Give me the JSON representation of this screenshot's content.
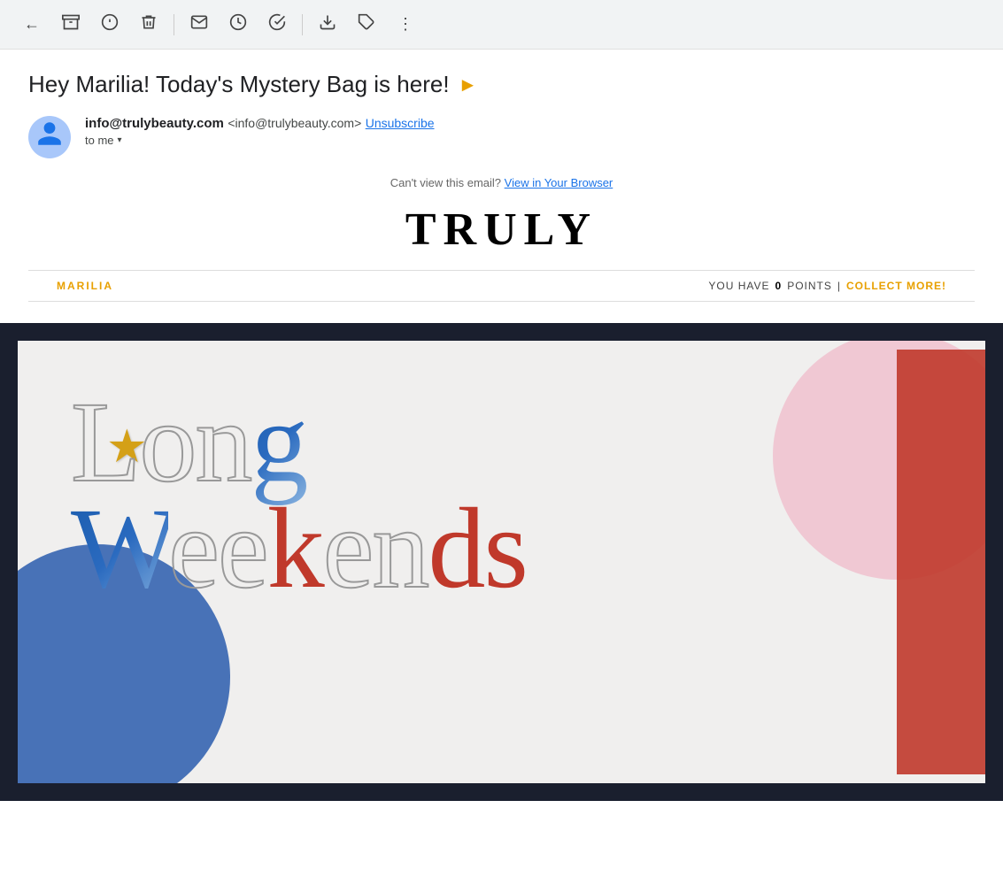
{
  "toolbar": {
    "back_icon": "←",
    "archive_icon": "⬇",
    "warning_icon": "⚠",
    "delete_icon": "🗑",
    "mail_icon": "✉",
    "clock_icon": "🕐",
    "check_icon": "✔",
    "download_icon": "⬇",
    "label_icon": "🏷",
    "more_icon": "⋮"
  },
  "email": {
    "subject": "Hey Marilia! Today's Mystery Bag is here!",
    "subject_arrow": "▶",
    "sender_display": "info@trulybeauty.com",
    "sender_email_bracket": "<info@trulybeauty.com>",
    "unsubscribe_label": "Unsubscribe",
    "to_label": "to me",
    "view_browser_text": "Can't view this email?",
    "view_browser_link": "View in Your Browser"
  },
  "brand": {
    "name": "TRULY"
  },
  "points_bar": {
    "user_name": "MARILIA",
    "points_prefix": "YOU HAVE",
    "points_value": "0",
    "points_suffix": "POINTS",
    "divider": "|",
    "collect_label": "COLLECT MORE!"
  },
  "hero_image": {
    "star": "★",
    "line1": "Long",
    "line2_part1": "Wee",
    "line2_part2": "k",
    "line2_part3": "ends"
  }
}
